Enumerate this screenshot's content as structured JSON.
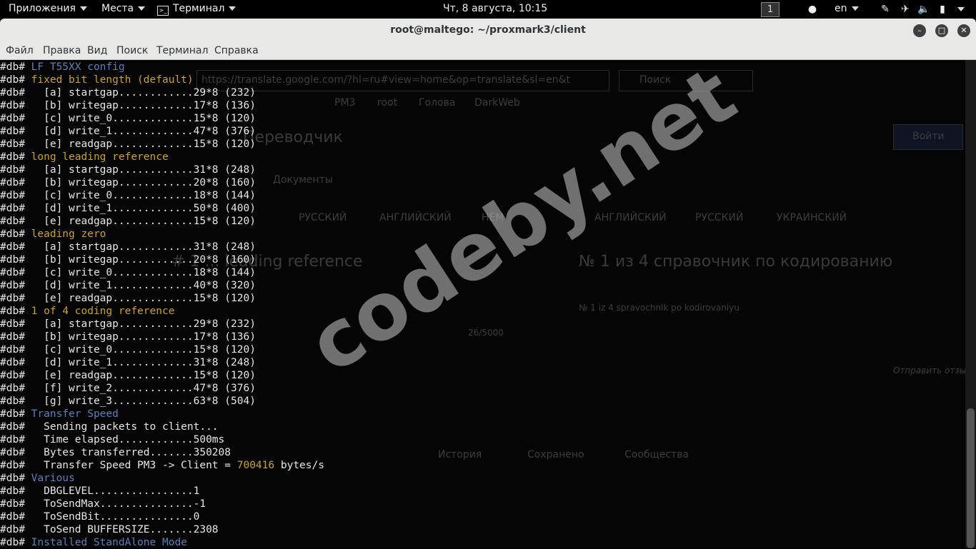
{
  "topbar": {
    "apps": "Приложения",
    "places": "Места",
    "terminal": "Терминал",
    "clock": "Чт, 8 августа, 10:15",
    "workspace": "1",
    "lang": "en"
  },
  "window": {
    "title": "root@maltego: ~/proxmark3/client",
    "menus": [
      "Файл",
      "Правка",
      "Вид",
      "Поиск",
      "Терминал",
      "Справка"
    ]
  },
  "browser_ghost": {
    "url": "https://translate.google.com/?hl=ru#view=home&op=translate&sl=en&t",
    "search_placeholder": "Поиск",
    "bookmarks": [
      "PM3",
      "root",
      "Голова",
      "DarkWeb"
    ],
    "app_name": "Переводчик",
    "login": "Войти",
    "documents": "Документы",
    "lang_tabs_left": [
      "РУССКИЙ",
      "АНГЛИЙСКИЙ",
      "НЕМ"
    ],
    "lang_tabs_right": [
      "АНГЛИЙСКИЙ",
      "РУССКИЙ",
      "УКРАИНСКИЙ"
    ],
    "source_text": "# 1 ... leading reference",
    "result_text": "№ 1 из 4 справочник по кодированию",
    "transliteration": "№ 1 iz 4 spravochnik po kodirovaniyu",
    "char_count": "26/5000",
    "feedback": "Отправить отзыв",
    "footer": [
      "История",
      "Сохранено",
      "Сообщества"
    ]
  },
  "terminal_lines": [
    [
      [
        "p",
        "#db# "
      ],
      [
        "b",
        "LF T55XX config"
      ]
    ],
    [
      [
        "p",
        "#db# "
      ],
      [
        "y",
        "fixed bit length (default)"
      ]
    ],
    [
      [
        "p",
        "#db#   [a] startgap............29*8 (232)"
      ]
    ],
    [
      [
        "p",
        "#db#   [b] writegap............17*8 (136)"
      ]
    ],
    [
      [
        "p",
        "#db#   [c] write_0.............15*8 (120)"
      ]
    ],
    [
      [
        "p",
        "#db#   [d] write_1.............47*8 (376)"
      ]
    ],
    [
      [
        "p",
        "#db#   [e] readgap.............15*8 (120)"
      ]
    ],
    [
      [
        "p",
        "#db# "
      ],
      [
        "y",
        "long leading reference"
      ]
    ],
    [
      [
        "p",
        "#db#   [a] startgap............31*8 (248)"
      ]
    ],
    [
      [
        "p",
        "#db#   [b] writegap............20*8 (160)"
      ]
    ],
    [
      [
        "p",
        "#db#   [c] write_0.............18*8 (144)"
      ]
    ],
    [
      [
        "p",
        "#db#   [d] write_1.............50*8 (400)"
      ]
    ],
    [
      [
        "p",
        "#db#   [e] readgap.............15*8 (120)"
      ]
    ],
    [
      [
        "p",
        "#db# "
      ],
      [
        "y",
        "leading zero"
      ]
    ],
    [
      [
        "p",
        "#db#   [a] startgap............31*8 (248)"
      ]
    ],
    [
      [
        "p",
        "#db#   [b] writegap............20*8 (160)"
      ]
    ],
    [
      [
        "p",
        "#db#   [c] write_0.............18*8 (144)"
      ]
    ],
    [
      [
        "p",
        "#db#   [d] write_1.............40*8 (320)"
      ]
    ],
    [
      [
        "p",
        "#db#   [e] readgap.............15*8 (120)"
      ]
    ],
    [
      [
        "p",
        "#db# "
      ],
      [
        "y",
        "1 of 4 coding reference"
      ]
    ],
    [
      [
        "p",
        "#db#   [a] startgap............29*8 (232)"
      ]
    ],
    [
      [
        "p",
        "#db#   [b] writegap............17*8 (136)"
      ]
    ],
    [
      [
        "p",
        "#db#   [c] write_0.............15*8 (120)"
      ]
    ],
    [
      [
        "p",
        "#db#   [d] write_1.............31*8 (248)"
      ]
    ],
    [
      [
        "p",
        "#db#   [e] readgap.............15*8 (120)"
      ]
    ],
    [
      [
        "p",
        "#db#   [f] write_2.............47*8 (376)"
      ]
    ],
    [
      [
        "p",
        "#db#   [g] write_3.............63*8 (504)"
      ]
    ],
    [
      [
        "p",
        "#db# "
      ],
      [
        "b",
        "Transfer Speed"
      ]
    ],
    [
      [
        "p",
        "#db#   Sending packets to client..."
      ]
    ],
    [
      [
        "p",
        "#db#   Time elapsed............500ms"
      ]
    ],
    [
      [
        "p",
        "#db#   Bytes transferred.......350208"
      ]
    ],
    [
      [
        "p",
        "#db#   Transfer Speed PM3 -> Client = "
      ],
      [
        "y",
        "700416"
      ],
      [
        "p",
        " bytes/s"
      ]
    ],
    [
      [
        "p",
        "#db# "
      ],
      [
        "b",
        "Various"
      ]
    ],
    [
      [
        "p",
        "#db#   DBGLEVEL................1"
      ]
    ],
    [
      [
        "p",
        "#db#   ToSendMax...............-1"
      ]
    ],
    [
      [
        "p",
        "#db#   ToSendBit...............0"
      ]
    ],
    [
      [
        "p",
        "#db#   ToSend BUFFERSIZE.......2308"
      ]
    ],
    [
      [
        "p",
        "#db# "
      ],
      [
        "b",
        "Installed StandAlone Mode"
      ]
    ]
  ],
  "watermark": "codeby.net"
}
